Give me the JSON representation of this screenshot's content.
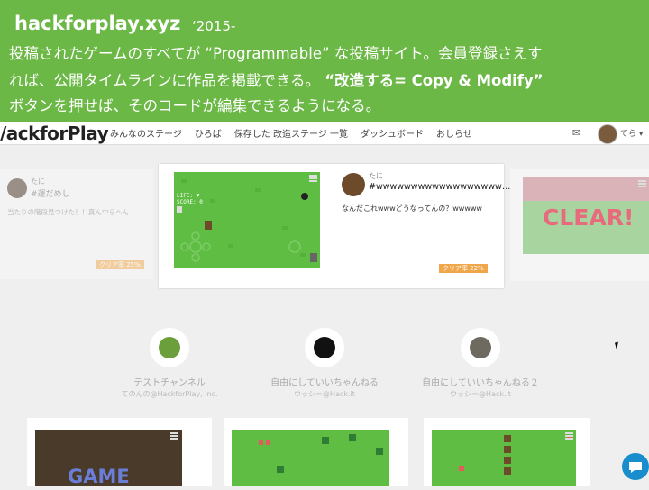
{
  "banner": {
    "site": "hackforplay.xyz",
    "year": "‘2015-",
    "line1": "投稿されたゲームのすべてが “Programmable” な投稿サイト。会員登録さえす",
    "line2_a": "れば、公開タイムラインに作品を掲載できる。 ",
    "line2_b": "“改造する= Copy & Modify”",
    "line3": "ボタンを押せば、そのコードが編集できるようになる。"
  },
  "nav": {
    "logo": "/ackforPlay",
    "menu": [
      "みんなのステージ",
      "ひろば",
      "保存した 改造ステージ 一覧",
      "ダッシュボード",
      "おしらせ"
    ],
    "mail_icon": "mail-icon",
    "username": "てら ▾"
  },
  "cards": {
    "left": {
      "username": "たに",
      "tag": "#運だめし",
      "message": "当たりの階段見つけた！！真ん中らへん",
      "badge": "クリア率 25%"
    },
    "main": {
      "username": "たに",
      "tag": "#wwwwwwwwwwwwwwwwww…",
      "message": "なんだこれwwwどうなってんの？wwwww",
      "badge": "クリア率 22%",
      "hud_life": "LIFE: ♥",
      "hud_score": "SCORE: 0"
    },
    "right": {
      "clear_text": "CLEAR!"
    }
  },
  "channels": [
    {
      "title": "テストチャンネル",
      "sub": "てのんの@HackforPlay, Inc."
    },
    {
      "title": "自由にしていいちゃんねる",
      "sub": "ウッシー@Hack.it"
    },
    {
      "title": "自由にしていいちゃんねる２",
      "sub": "ウッシー@Hack.it"
    }
  ],
  "bottom": {
    "gameover": "GAME"
  },
  "colors": {
    "banner": "#6cb846",
    "badge": "#f0a64a",
    "chat": "#1a8ecd"
  }
}
